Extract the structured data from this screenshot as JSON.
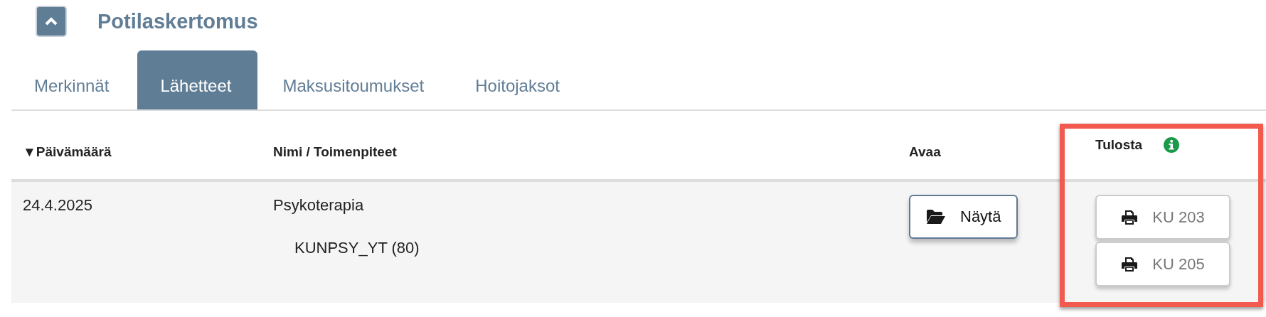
{
  "section": {
    "title": "Potilaskertomus",
    "expanded": true
  },
  "tabs": [
    {
      "label": "Merkinnät",
      "selected": false
    },
    {
      "label": "Lähetteet",
      "selected": true
    },
    {
      "label": "Maksusitoumukset",
      "selected": false
    },
    {
      "label": "Hoitojaksot",
      "selected": false
    }
  ],
  "table": {
    "columns": [
      {
        "label": "Päivämäärä",
        "sort_indicator": "▼",
        "highlighted": false,
        "info": false
      },
      {
        "label": "Nimi / Toimenpiteet",
        "highlighted": false,
        "info": false
      },
      {
        "label": "Avaa",
        "highlighted": false,
        "info": false
      },
      {
        "label": "Tulosta",
        "highlighted": true,
        "info": true
      }
    ],
    "rows": [
      {
        "date": "24.4.2025",
        "name": "Psykoterapia",
        "procedures": [
          "KUNPSY_YT (80)"
        ],
        "open_button": "Näytä",
        "print_buttons": [
          "KU 203",
          "KU 205"
        ]
      }
    ]
  }
}
